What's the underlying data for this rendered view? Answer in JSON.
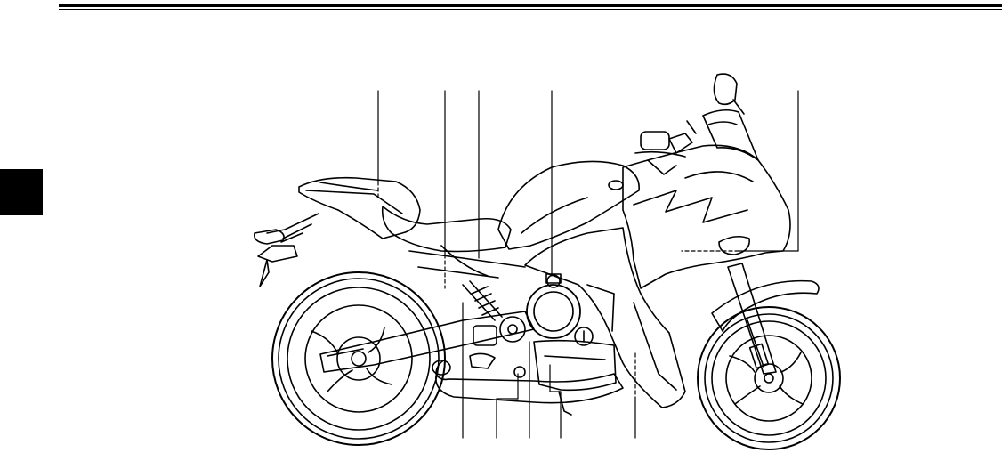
{
  "header": {
    "chapter_tab_label": ""
  },
  "illustration": {
    "subject": "motorcycle-left-side-view",
    "callout_numbers": []
  },
  "colors": {
    "ink": "#000000",
    "paper": "#ffffff",
    "tab": "#000000"
  }
}
